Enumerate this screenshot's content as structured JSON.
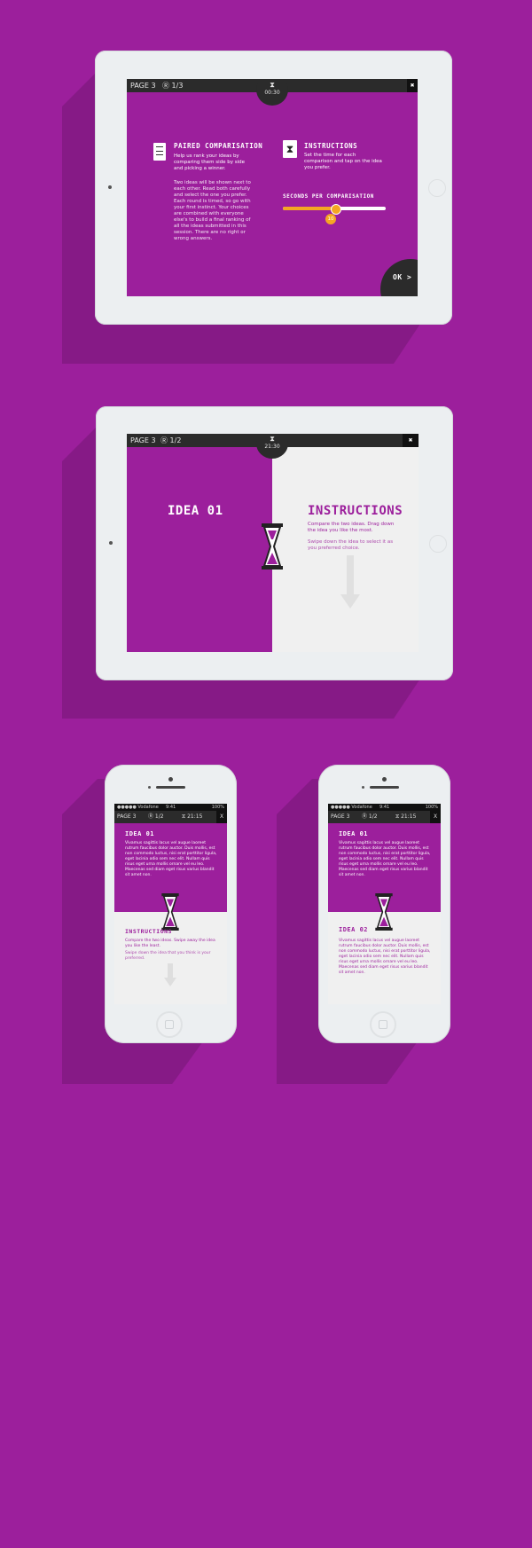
{
  "tablet1": {
    "bar": {
      "page": "PAGE 3",
      "votes": "Ⓡ 1/3",
      "close": "✖"
    },
    "hub": {
      "icon": "hourglass-icon",
      "time": "00:30"
    },
    "paired": {
      "title": "PAIRED COMPARISATION",
      "lead": "Help us rank your ideas by comparing them side by side and picking a winner.",
      "body": "Two ideas will be shown next to each other. Read both carefully and select the one you prefer. Each round is timed, so go with your first instinct. Your choices are combined with everyone else's to build a final ranking of all the ideas submitted in this session. There are no right or wrong answers."
    },
    "instructions": {
      "title": "INSTRUCTIONS",
      "body": "Set the time for each comparison and tap on the idea you prefer."
    },
    "slider": {
      "label": "SECONDS PER COMPARISATION",
      "value": "10",
      "fraction": 0.5
    },
    "ok": "OK >"
  },
  "tablet2": {
    "bar": {
      "page": "PAGE 3",
      "votes": "Ⓡ 1/2",
      "close": "✖"
    },
    "hub": {
      "time": "21:30"
    },
    "idea": "IDEA 01",
    "instructions": {
      "title": "INSTRUCTIONS",
      "line1": "Compare the two ideas. Drag down the idea you like the most.",
      "line2": "Swipe down the idea to select it as you preferred choice."
    }
  },
  "phone1": {
    "status": {
      "carrier": "●●●●● Vodafone",
      "time": "9:41",
      "battery": "100%"
    },
    "bar": {
      "page": "PAGE 3",
      "votes": "Ⓡ 1/2",
      "timer": "⧖ 21:15",
      "close": "X"
    },
    "idea_title": "IDEA 01",
    "idea_text": "Vivamus sagittis lacus vel augue laoreet rutrum faucibus dolor auctor. Duis mollis, est non commodo luctus, nisi erat porttitor ligula, eget lacinia odio sem nec elit. Nullam quis risus eget urna mollis ornare vel eu leo. Maecenas sed diam eget risus varius blandit sit amet non.",
    "instr_title": "INSTRUCTIONS",
    "instr_line1": "Compare the two ideas. Swipe away the idea you like the least.",
    "instr_line2": "Swipe down the idea that you think is your preferred."
  },
  "phone2": {
    "status": {
      "carrier": "●●●●● Vodafone",
      "time": "9:41",
      "battery": "100%"
    },
    "bar": {
      "page": "PAGE 3",
      "votes": "Ⓡ 1/2",
      "timer": "⧖ 21:15",
      "close": "X"
    },
    "idea1_title": "IDEA 01",
    "idea1_text": "Vivamus sagittis lacus vel augue laoreet rutrum faucibus dolor auctor. Duis mollis, est non commodo luctus, nisi erat porttitor ligula, eget lacinia odio sem nec elit. Nullam quis risus eget urna mollis ornare vel eu leo. Maecenas sed diam eget risus varius blandit sit amet non.",
    "idea2_title": "IDEA 02",
    "idea2_text": "Vivamus sagittis lacus vel augue laoreet rutrum faucibus dolor auctor. Duis mollis, est non commodo luctus, nisi erat porttitor ligula, eget lacinia odio sem nec elit. Nullam quis risus eget urna mollis ornare vel eu leo. Maecenas sed diam eget risus varius blandit sit amet non."
  },
  "colors": {
    "background": "#9c1f9c",
    "accent": "#f5a623",
    "dark": "#2b2b2b",
    "light": "#f0f0f0"
  }
}
